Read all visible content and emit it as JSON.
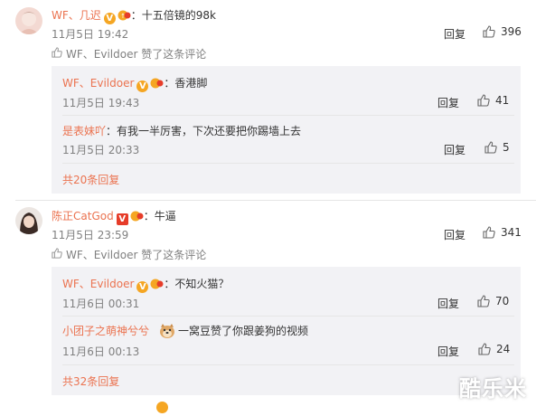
{
  "colors": {
    "name": "#eb7350",
    "text": "#333333",
    "muted": "#808080",
    "reply_bg": "#f2f2f5"
  },
  "comments": [
    {
      "user": "WF、几迟",
      "text": "：十五倍镜的98k",
      "time": "11月5日 19:42",
      "reply_label": "回复",
      "likes": "396",
      "liked_by": "WF、Evildoer 赞了这条评论",
      "replies": [
        {
          "user": "WF、Evildoer",
          "text": "：香港脚",
          "time": "11月5日 19:43",
          "reply_label": "回复",
          "likes": "41"
        },
        {
          "user": "是表妹吖",
          "text": "：有我一半厉害，下次还要把你踢墙上去",
          "time": "11月5日 20:33",
          "reply_label": "回复",
          "likes": "5"
        }
      ],
      "more": "共20条回复"
    },
    {
      "user": "陈正CatGod",
      "text": "：牛逼",
      "time": "11月5日 23:59",
      "reply_label": "回复",
      "likes": "341",
      "liked_by": "WF、Evildoer 赞了这条评论",
      "replies": [
        {
          "user": "WF、Evildoer",
          "text": "：不知火猫？",
          "time": "11月6日 00:31",
          "reply_label": "回复",
          "likes": "70"
        },
        {
          "user": "小团子之萌神兮兮",
          "text": "一窝豆赞了你跟姜狗的视频",
          "time": "11月6日 00:13",
          "reply_label": "回复",
          "likes": "24"
        }
      ],
      "more": "共32条回复"
    }
  ],
  "watermark": "酷乐米"
}
